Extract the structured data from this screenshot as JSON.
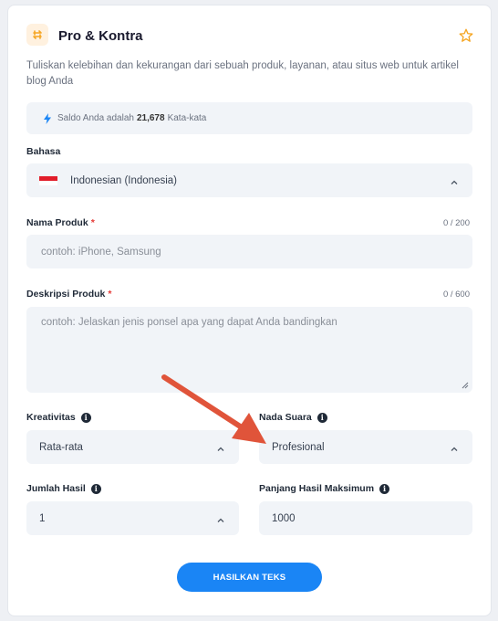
{
  "header": {
    "title": "Pro & Kontra",
    "description": "Tuliskan kelebihan dan kekurangan dari sebuah produk, layanan, atau situs web untuk artikel blog Anda"
  },
  "balance": {
    "prefix": "Saldo Anda adalah",
    "amount": "21,678",
    "suffix": "Kata-kata"
  },
  "language": {
    "label": "Bahasa",
    "value": "Indonesian (Indonesia)"
  },
  "product_name": {
    "label": "Nama Produk",
    "required": "*",
    "counter": "0 / 200",
    "placeholder": "contoh: iPhone, Samsung"
  },
  "product_desc": {
    "label": "Deskripsi Produk",
    "required": "*",
    "counter": "0 / 600",
    "placeholder": "contoh: Jelaskan jenis ponsel apa yang dapat Anda bandingkan"
  },
  "creativity": {
    "label": "Kreativitas",
    "value": "Rata-rata"
  },
  "tone": {
    "label": "Nada Suara",
    "value": "Profesional"
  },
  "result_count": {
    "label": "Jumlah Hasil",
    "value": "1"
  },
  "max_length": {
    "label": "Panjang Hasil Maksimum",
    "value": "1000"
  },
  "generate_button": "HASILKAN TEKS",
  "icons": {
    "header": "swap-icon",
    "favorite": "star-icon",
    "balance": "lightning-icon",
    "info": "info-icon",
    "chevron": "chevron-up-icon"
  },
  "colors": {
    "accent": "#1a85f5",
    "header_icon": "#f5a623",
    "required": "#e53935",
    "annotation_arrow": "#e0543a"
  }
}
